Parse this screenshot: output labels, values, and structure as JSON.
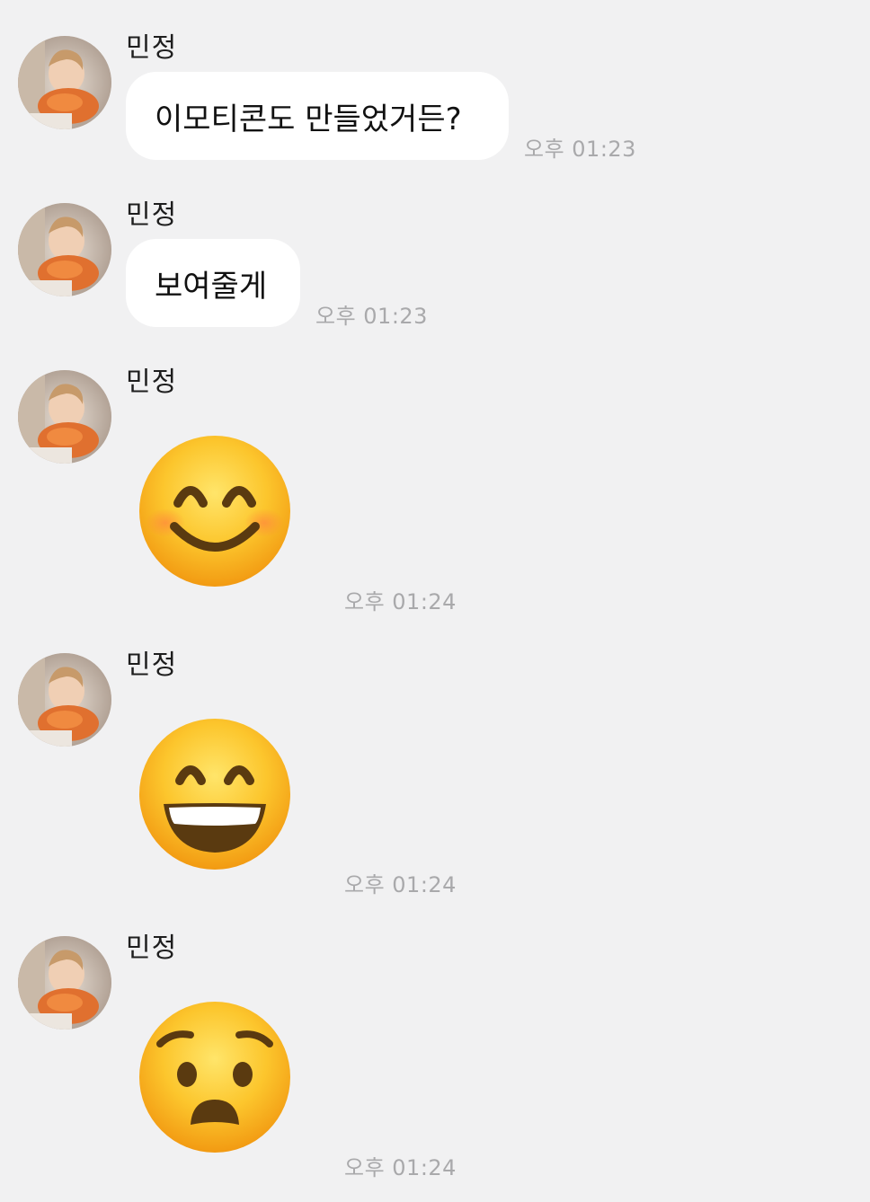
{
  "sender": "민정",
  "messages": [
    {
      "type": "text",
      "text": "이모티콘도 만들었거든?",
      "time": "오후 01:23"
    },
    {
      "type": "text",
      "text": "보여줄게",
      "time": "오후 01:23"
    },
    {
      "type": "emoticon",
      "icon": "smiling-face-with-smiling-eyes",
      "time": "오후 01:24"
    },
    {
      "type": "emoticon",
      "icon": "grinning-face-with-smiling-eyes",
      "time": "오후 01:24"
    },
    {
      "type": "emoticon",
      "icon": "worried-frowning-face",
      "time": "오후 01:24"
    }
  ],
  "colors": {
    "background": "#f1f1f2",
    "bubble": "#ffffff",
    "timestamp": "#a9a9ab",
    "emoji_face": "#fbc42c"
  }
}
